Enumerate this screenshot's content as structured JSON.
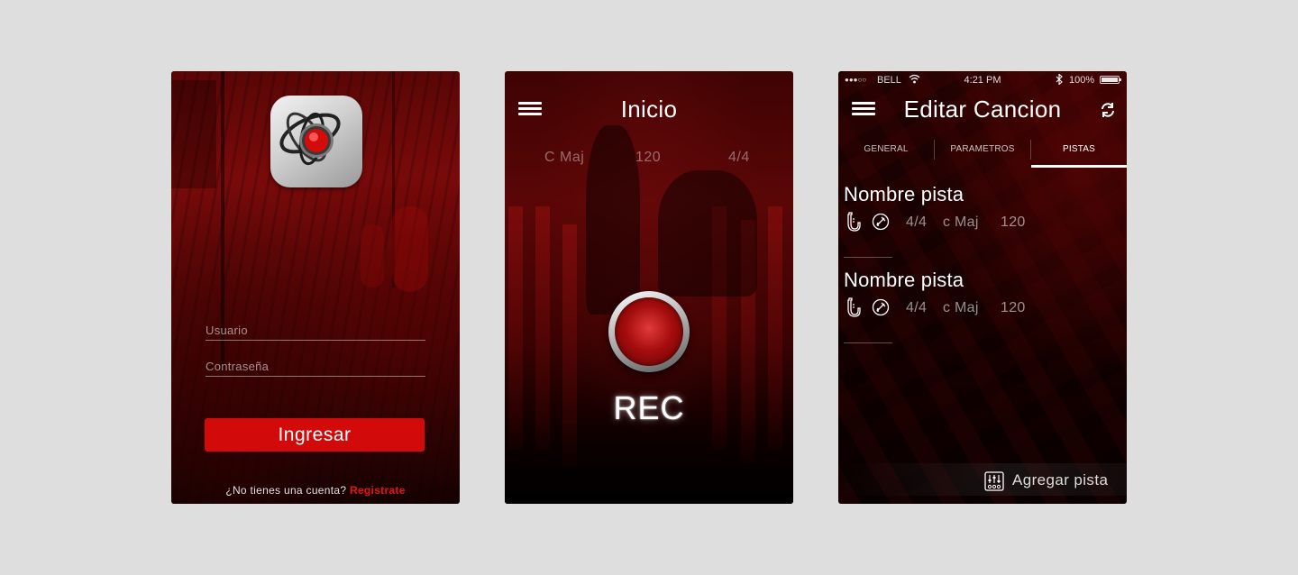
{
  "login": {
    "icon": "atom-record-app-icon",
    "username_placeholder": "Usuario",
    "password_placeholder": "Contraseña",
    "login_label": "Ingresar",
    "no_account_text": "¿No tienes una cuenta?",
    "register_label": "Registrate",
    "colors": {
      "button": "#d20a0a",
      "link": "#e0161a"
    }
  },
  "home": {
    "title": "Inicio",
    "key": "C Maj",
    "tempo": "120",
    "time_signature": "4/4",
    "rec_label": "REC"
  },
  "edit": {
    "status": {
      "signal": "●●●○○",
      "carrier": "BELL",
      "time": "4:21 PM",
      "battery": "100%"
    },
    "title": "Editar Cancion",
    "tabs": [
      {
        "label": "GENERAL",
        "active": false
      },
      {
        "label": "PARAMETROS",
        "active": false
      },
      {
        "label": "PISTAS",
        "active": true
      }
    ],
    "tracks": [
      {
        "name": "Nombre pista",
        "instrument": "saxophone-icon",
        "mode": "guitar-pick-icon",
        "time_signature": "4/4",
        "key": "c Maj",
        "tempo": "120"
      },
      {
        "name": "Nombre pista",
        "instrument": "saxophone-icon",
        "mode": "guitar-pick-icon",
        "time_signature": "4/4",
        "key": "c Maj",
        "tempo": "120"
      }
    ],
    "add_track_label": "Agregar pista"
  }
}
